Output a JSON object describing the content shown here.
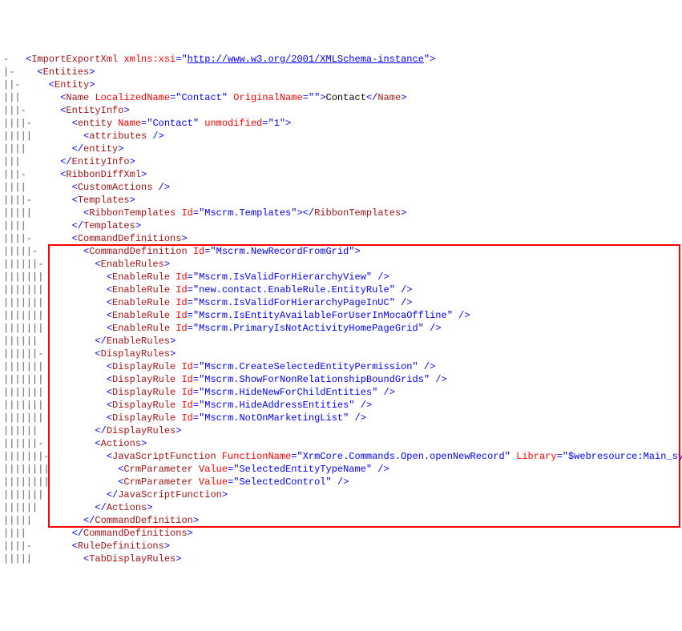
{
  "url": "http://www.w3.org/2001/XMLSchema-instance",
  "lines": [
    {
      "indent": 0,
      "gutter": "-",
      "type": "open",
      "tag": "ImportExportXml",
      "attrs": [
        {
          "n": "xmlns:xsi",
          "v": "URL"
        }
      ]
    },
    {
      "indent": 1,
      "gutter": " -",
      "type": "open",
      "tag": "Entities"
    },
    {
      "indent": 2,
      "gutter": "  -",
      "type": "open",
      "tag": "Entity"
    },
    {
      "indent": 3,
      "gutter": "   ",
      "type": "open-text-close",
      "tag": "Name",
      "attrs": [
        {
          "n": "LocalizedName",
          "v": "Contact"
        },
        {
          "n": "OriginalName",
          "v": ""
        }
      ],
      "text": "Contact"
    },
    {
      "indent": 3,
      "gutter": "  -",
      "type": "open",
      "tag": "EntityInfo"
    },
    {
      "indent": 4,
      "gutter": "   -",
      "type": "open",
      "tag": "entity",
      "attrs": [
        {
          "n": "Name",
          "v": "Contact"
        },
        {
          "n": "unmodified",
          "v": "1"
        }
      ]
    },
    {
      "indent": 5,
      "gutter": "    ",
      "type": "self",
      "tag": "attributes"
    },
    {
      "indent": 4,
      "gutter": "    ",
      "type": "close",
      "tag": "entity"
    },
    {
      "indent": 3,
      "gutter": "   ",
      "type": "close",
      "tag": "EntityInfo"
    },
    {
      "indent": 3,
      "gutter": "  -",
      "type": "open",
      "tag": "RibbonDiffXml"
    },
    {
      "indent": 4,
      "gutter": "    ",
      "type": "self",
      "tag": "CustomActions"
    },
    {
      "indent": 4,
      "gutter": "   -",
      "type": "open",
      "tag": "Templates"
    },
    {
      "indent": 5,
      "gutter": "    ",
      "type": "open-close",
      "tag": "RibbonTemplates",
      "attrs": [
        {
          "n": "Id",
          "v": "Mscrm.Templates"
        }
      ]
    },
    {
      "indent": 4,
      "gutter": "    ",
      "type": "close",
      "tag": "Templates"
    },
    {
      "indent": 4,
      "gutter": "   -",
      "type": "open",
      "tag": "CommandDefinitions"
    },
    {
      "indent": 5,
      "gutter": "    -",
      "type": "open",
      "tag": "CommandDefinition",
      "attrs": [
        {
          "n": "Id",
          "v": "Mscrm.NewRecordFromGrid"
        }
      ],
      "box": "start"
    },
    {
      "indent": 6,
      "gutter": "     -",
      "type": "open",
      "tag": "EnableRules"
    },
    {
      "indent": 7,
      "gutter": "      ",
      "type": "self",
      "tag": "EnableRule",
      "attrs": [
        {
          "n": "Id",
          "v": "Mscrm.IsValidForHierarchyView"
        }
      ]
    },
    {
      "indent": 7,
      "gutter": "      ",
      "type": "self",
      "tag": "EnableRule",
      "attrs": [
        {
          "n": "Id",
          "v": "new.contact.EnableRule.EntityRule"
        }
      ]
    },
    {
      "indent": 7,
      "gutter": "      ",
      "type": "self",
      "tag": "EnableRule",
      "attrs": [
        {
          "n": "Id",
          "v": "Mscrm.IsValidForHierarchyPageInUC"
        }
      ]
    },
    {
      "indent": 7,
      "gutter": "      ",
      "type": "self",
      "tag": "EnableRule",
      "attrs": [
        {
          "n": "Id",
          "v": "Mscrm.IsEntityAvailableForUserInMocaOffline"
        }
      ]
    },
    {
      "indent": 7,
      "gutter": "      ",
      "type": "self",
      "tag": "EnableRule",
      "attrs": [
        {
          "n": "Id",
          "v": "Mscrm.PrimaryIsNotActivityHomePageGrid"
        }
      ]
    },
    {
      "indent": 6,
      "gutter": "      ",
      "type": "close",
      "tag": "EnableRules"
    },
    {
      "indent": 6,
      "gutter": "     -",
      "type": "open",
      "tag": "DisplayRules"
    },
    {
      "indent": 7,
      "gutter": "      ",
      "type": "self",
      "tag": "DisplayRule",
      "attrs": [
        {
          "n": "Id",
          "v": "Mscrm.CreateSelectedEntityPermission"
        }
      ]
    },
    {
      "indent": 7,
      "gutter": "      ",
      "type": "self",
      "tag": "DisplayRule",
      "attrs": [
        {
          "n": "Id",
          "v": "Mscrm.ShowForNonRelationshipBoundGrids"
        }
      ]
    },
    {
      "indent": 7,
      "gutter": "      ",
      "type": "self",
      "tag": "DisplayRule",
      "attrs": [
        {
          "n": "Id",
          "v": "Mscrm.HideNewForChildEntities"
        }
      ]
    },
    {
      "indent": 7,
      "gutter": "      ",
      "type": "self",
      "tag": "DisplayRule",
      "attrs": [
        {
          "n": "Id",
          "v": "Mscrm.HideAddressEntities"
        }
      ]
    },
    {
      "indent": 7,
      "gutter": "      ",
      "type": "self",
      "tag": "DisplayRule",
      "attrs": [
        {
          "n": "Id",
          "v": "Mscrm.NotOnMarketingList"
        }
      ]
    },
    {
      "indent": 6,
      "gutter": "      ",
      "type": "close",
      "tag": "DisplayRules"
    },
    {
      "indent": 6,
      "gutter": "     -",
      "type": "open",
      "tag": "Actions"
    },
    {
      "indent": 7,
      "gutter": "      -",
      "type": "open",
      "tag": "JavaScriptFunction",
      "attrs": [
        {
          "n": "FunctionName",
          "v": "XrmCore.Commands.Open.openNewRecord"
        },
        {
          "n": "Library",
          "v": "$webresource:Main_system_library.js"
        }
      ]
    },
    {
      "indent": 8,
      "gutter": "       ",
      "type": "self",
      "tag": "CrmParameter",
      "attrs": [
        {
          "n": "Value",
          "v": "SelectedEntityTypeName"
        }
      ]
    },
    {
      "indent": 8,
      "gutter": "       ",
      "type": "self",
      "tag": "CrmParameter",
      "attrs": [
        {
          "n": "Value",
          "v": "SelectedControl"
        }
      ]
    },
    {
      "indent": 7,
      "gutter": "       ",
      "type": "close",
      "tag": "JavaScriptFunction"
    },
    {
      "indent": 6,
      "gutter": "      ",
      "type": "close",
      "tag": "Actions"
    },
    {
      "indent": 5,
      "gutter": "     ",
      "type": "close",
      "tag": "CommandDefinition",
      "box": "end"
    },
    {
      "indent": 4,
      "gutter": "    ",
      "type": "close",
      "tag": "CommandDefinitions"
    },
    {
      "indent": 4,
      "gutter": "   -",
      "type": "open",
      "tag": "RuleDefinitions"
    },
    {
      "indent": 5,
      "gutter": "    ",
      "type": "open",
      "tag": "TabDisplayRules"
    }
  ]
}
